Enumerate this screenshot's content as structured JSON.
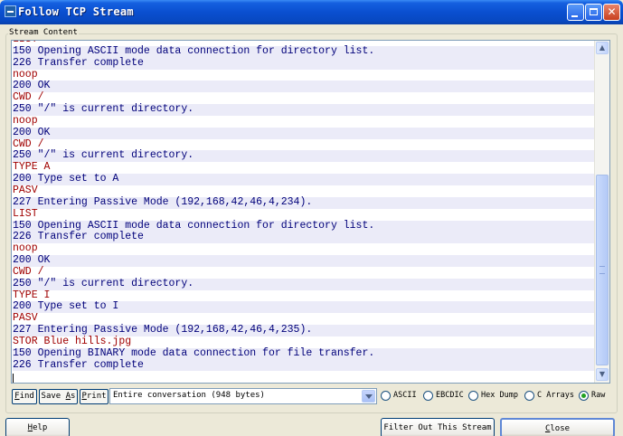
{
  "window": {
    "title": "Follow TCP Stream"
  },
  "group_label": "Stream Content",
  "lines": [
    {
      "text": "LIST",
      "who": "client"
    },
    {
      "text": "150 Opening ASCII mode data connection for directory list.",
      "who": "server"
    },
    {
      "text": "226 Transfer complete",
      "who": "server"
    },
    {
      "text": "noop",
      "who": "client"
    },
    {
      "text": "200 OK",
      "who": "server"
    },
    {
      "text": "CWD /",
      "who": "client"
    },
    {
      "text": "250 \"/\" is current directory.",
      "who": "server"
    },
    {
      "text": "noop",
      "who": "client"
    },
    {
      "text": "200 OK",
      "who": "server"
    },
    {
      "text": "CWD /",
      "who": "client"
    },
    {
      "text": "250 \"/\" is current directory.",
      "who": "server"
    },
    {
      "text": "TYPE A",
      "who": "client"
    },
    {
      "text": "200 Type set to A",
      "who": "server"
    },
    {
      "text": "PASV",
      "who": "client"
    },
    {
      "text": "227 Entering Passive Mode (192,168,42,46,4,234).",
      "who": "server"
    },
    {
      "text": "LIST",
      "who": "client"
    },
    {
      "text": "150 Opening ASCII mode data connection for directory list.",
      "who": "server"
    },
    {
      "text": "226 Transfer complete",
      "who": "server"
    },
    {
      "text": "noop",
      "who": "client"
    },
    {
      "text": "200 OK",
      "who": "server"
    },
    {
      "text": "CWD /",
      "who": "client"
    },
    {
      "text": "250 \"/\" is current directory.",
      "who": "server"
    },
    {
      "text": "TYPE I",
      "who": "client"
    },
    {
      "text": "200 Type set to I",
      "who": "server"
    },
    {
      "text": "PASV",
      "who": "client"
    },
    {
      "text": "227 Entering Passive Mode (192,168,42,46,4,235).",
      "who": "server"
    },
    {
      "text": "STOR Blue hills.jpg",
      "who": "client"
    },
    {
      "text": "150 Opening BINARY mode data connection for file transfer.",
      "who": "server"
    },
    {
      "text": "226 Transfer complete",
      "who": "server"
    }
  ],
  "toolbar": {
    "find": {
      "mnemonic": "F",
      "rest": "ind"
    },
    "save_as": {
      "before": "Save ",
      "mnemonic": "A",
      "rest": "s"
    },
    "print": {
      "mnemonic": "P",
      "rest": "rint"
    },
    "conversation": "Entire conversation (948 bytes)"
  },
  "formats": [
    {
      "label": "ASCII",
      "selected": false
    },
    {
      "label": "EBCDIC",
      "selected": false
    },
    {
      "label": "Hex Dump",
      "selected": false
    },
    {
      "label": "C Arrays",
      "selected": false
    },
    {
      "label": "Raw",
      "selected": true
    }
  ],
  "buttons": {
    "help": {
      "mnemonic": "H",
      "rest": "elp"
    },
    "filter_out": "Filter Out This Stream",
    "close": {
      "mnemonic": "C",
      "rest": "lose"
    }
  },
  "colors": {
    "client_text": "#a00000",
    "server_text": "#00007a",
    "server_bg": "#ebebf8",
    "title_bar": "#0a4fd0"
  }
}
